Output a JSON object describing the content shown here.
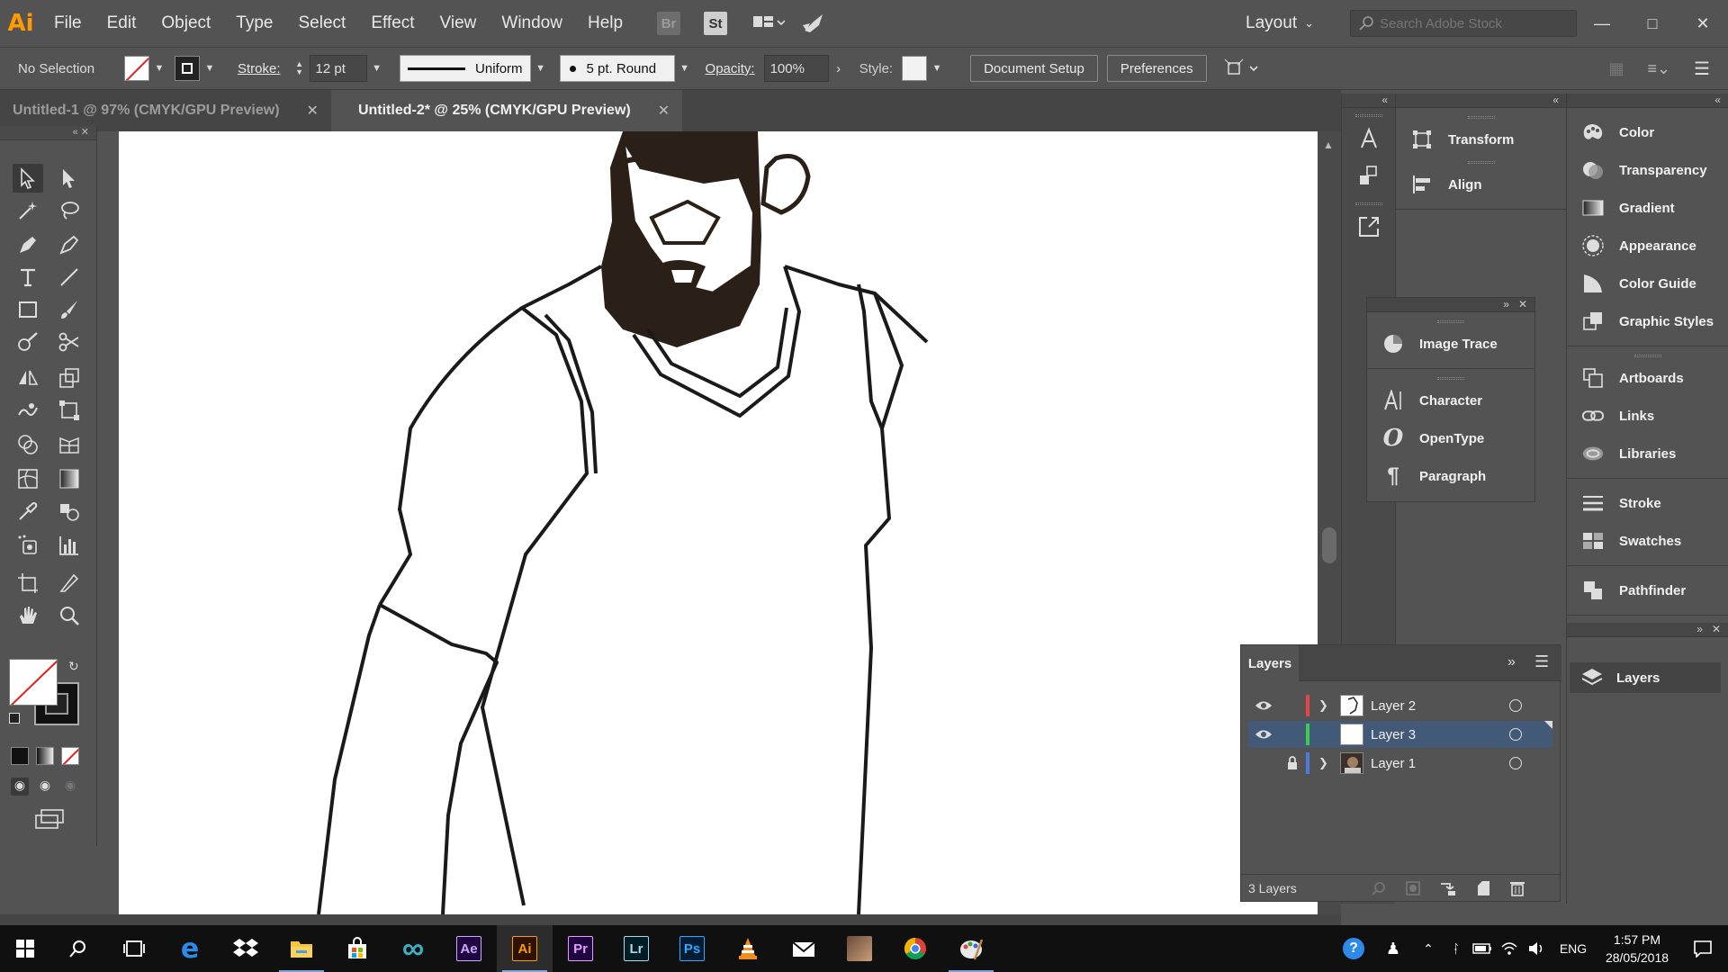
{
  "app": {
    "logo": "Ai"
  },
  "menu": [
    "File",
    "Edit",
    "Object",
    "Type",
    "Select",
    "Effect",
    "View",
    "Window",
    "Help"
  ],
  "menubar_icons": {
    "bridge": "Br",
    "stock": "St"
  },
  "workspace": {
    "label": "Layout"
  },
  "search": {
    "placeholder": "Search Adobe Stock"
  },
  "control": {
    "selection": "No Selection",
    "stroke_label": "Stroke:",
    "stroke_value": "12 pt",
    "profile": "Uniform",
    "brush": "5 pt. Round",
    "opacity_label": "Opacity:",
    "opacity_value": "100%",
    "style_label": "Style:",
    "document_setup": "Document Setup",
    "preferences": "Preferences"
  },
  "tabs": [
    {
      "label": "Untitled-1 @ 97% (CMYK/GPU Preview)",
      "active": false
    },
    {
      "label": "Untitled-2* @ 25% (CMYK/GPU Preview)",
      "active": true
    }
  ],
  "dock_mid": {
    "items": [
      "Transform",
      "Align"
    ]
  },
  "floating_panel": {
    "items": [
      "Image Trace",
      "Character",
      "OpenType",
      "Paragraph"
    ]
  },
  "dock_right": {
    "group1": [
      "Color",
      "Transparency",
      "Gradient",
      "Appearance",
      "Color Guide",
      "Graphic Styles"
    ],
    "group2": [
      "Artboards",
      "Links",
      "Libraries"
    ],
    "group3": [
      "Stroke",
      "Swatches"
    ],
    "group4": [
      "Pathfinder"
    ],
    "collapsed_layers": "Layers"
  },
  "layers_panel": {
    "title": "Layers",
    "rows": [
      {
        "name": "Layer 2",
        "color": "#e64545",
        "visible": true,
        "locked": false,
        "selected": false
      },
      {
        "name": "Layer 3",
        "color": "#3ccf4e",
        "visible": true,
        "locked": false,
        "selected": true
      },
      {
        "name": "Layer 1",
        "color": "#4a7be0",
        "visible": false,
        "locked": true,
        "selected": false
      }
    ],
    "count": "3 Layers"
  },
  "taskbar": {
    "apps": [
      "Ae",
      "Ai",
      "Pr",
      "Lr",
      "Ps"
    ],
    "language": "ENG",
    "time": "1:57 PM",
    "date": "28/05/2018"
  },
  "colors": {
    "ui_bg": "#535353",
    "ui_dark": "#454545",
    "selection_blue": "#425a78",
    "ai_orange": "#ff9a00"
  }
}
